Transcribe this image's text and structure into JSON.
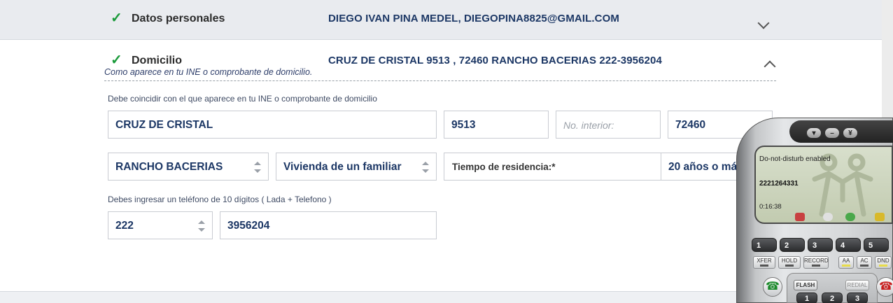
{
  "sections": {
    "personal": {
      "title": "Datos personales",
      "summary": "DIEGO IVAN PINA MEDEL, DIEGOPINA8825@GMAIL.COM"
    },
    "address": {
      "title": "Domicilio",
      "summary": "CRUZ DE CRISTAL 9513 , 72460 RANCHO BACERIAS 222-3956204",
      "subtitle": "Como aparece en tu INE o comprobante de domicilio."
    }
  },
  "address_form": {
    "hint": "Debe coincidir con el que aparece en tu INE o comprobante de domicilio",
    "street": "CRUZ DE CRISTAL",
    "ext_number": "9513",
    "int_number_placeholder": "No. interior:",
    "postal_code": "72460",
    "colony": "RANCHO BACERIAS",
    "housing_type": "Vivienda de un familiar",
    "residence_label": "Tiempo de residencia:*",
    "residence_value": "20 años o más"
  },
  "phone_form": {
    "hint": "Debes ingresar un teléfono de 10 dígitos ( Lada + Telefono )",
    "area_code": "222",
    "number": "3956204"
  },
  "softphone": {
    "status": "Do-not-disturb enabled",
    "number": "2221264331",
    "timer": "0:16:38",
    "line_keys": [
      "1",
      "2",
      "3",
      "4",
      "5"
    ],
    "func_keys": [
      "XFER",
      "HOLD",
      "RECORD",
      "AA",
      "AC",
      "DND"
    ],
    "flash_label": "FLASH",
    "redial_label": "REDIAL",
    "dial_keys": [
      "1",
      "2",
      "3"
    ]
  }
}
